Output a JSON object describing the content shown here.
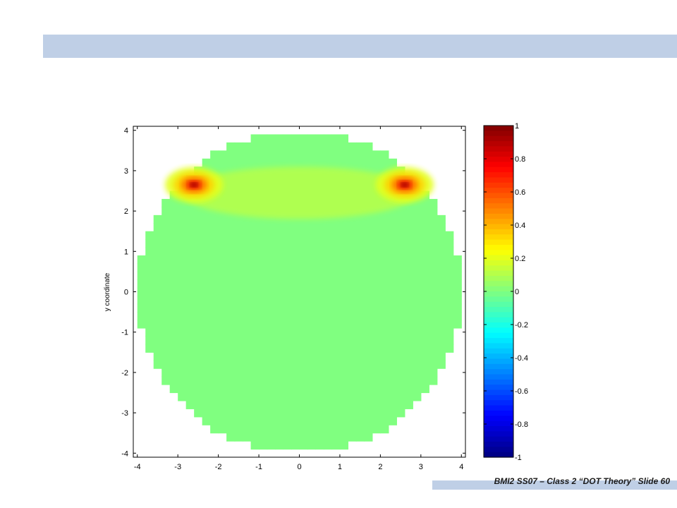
{
  "slide": {
    "footer": "BMI2 SS07 – Class 2 “DOT Theory” Slide 60",
    "band_color": "#bfcfe6"
  },
  "chart_data": {
    "type": "heatmap",
    "title": "",
    "xlabel": "",
    "ylabel": "y coordinate",
    "xlim": [
      -4.1,
      4.1
    ],
    "ylim": [
      -4.1,
      4.1
    ],
    "x_ticks": [
      -4,
      -3,
      -2,
      -1,
      0,
      1,
      2,
      3,
      4
    ],
    "y_ticks": [
      -4,
      -3,
      -2,
      -1,
      0,
      1,
      2,
      3,
      4
    ],
    "x_tick_labels": [
      "-4",
      "-3",
      "-2",
      "-1",
      "0",
      "1",
      "2",
      "3",
      "4"
    ],
    "y_tick_labels": [
      "-4",
      "-3",
      "-2",
      "-1",
      "0",
      "1",
      "2",
      "3",
      "4"
    ],
    "grid": false,
    "domain": {
      "shape": "disk",
      "center": [
        0,
        0
      ],
      "radius": 4.0
    },
    "background_value": 0,
    "hotspots": [
      {
        "x": -2.6,
        "y": 2.65,
        "peak": 1.0
      },
      {
        "x": 2.6,
        "y": 2.65,
        "peak": 1.0
      }
    ],
    "colorbar": {
      "colormap": "jet",
      "range": [
        -1,
        1
      ],
      "ticks": [
        1,
        0.8,
        0.6,
        0.4,
        0.2,
        0,
        -0.2,
        -0.4,
        -0.6,
        -0.8,
        -1
      ],
      "tick_labels": [
        "1",
        "0.8",
        "0.6",
        "0.4",
        "0.2",
        "0",
        "-0.2",
        "-0.4",
        "-0.6",
        "-0.8",
        "-1"
      ]
    }
  }
}
